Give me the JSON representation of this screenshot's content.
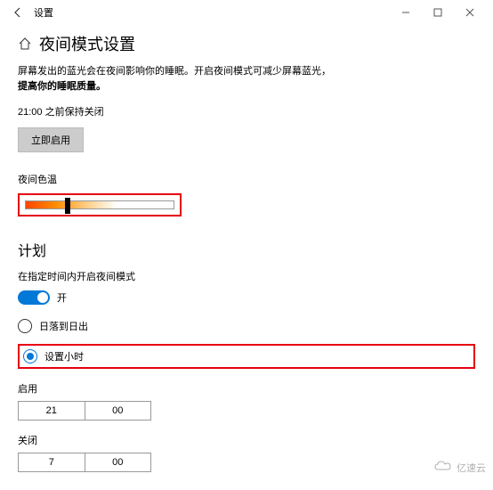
{
  "titlebar": {
    "back": "←",
    "title": "设置"
  },
  "page": {
    "title": "夜间模式设置",
    "desc1": "屏幕发出的蓝光会在夜间影响你的睡眠。开启夜间模式可减少屏幕蓝光，",
    "desc2": "提高你的睡眠质量。",
    "status": "21:00 之前保持关闭",
    "enable_now": "立即启用",
    "color_temp": "夜间色温"
  },
  "schedule": {
    "title": "计划",
    "sub": "在指定时间内开启夜间模式",
    "toggle": "开",
    "radio1": "日落到日出",
    "radio2": "设置小时",
    "on_label": "启用",
    "on_hour": "21",
    "on_min": "00",
    "off_label": "关闭",
    "off_hour": "7",
    "off_min": "00"
  },
  "watermark": "亿速云"
}
